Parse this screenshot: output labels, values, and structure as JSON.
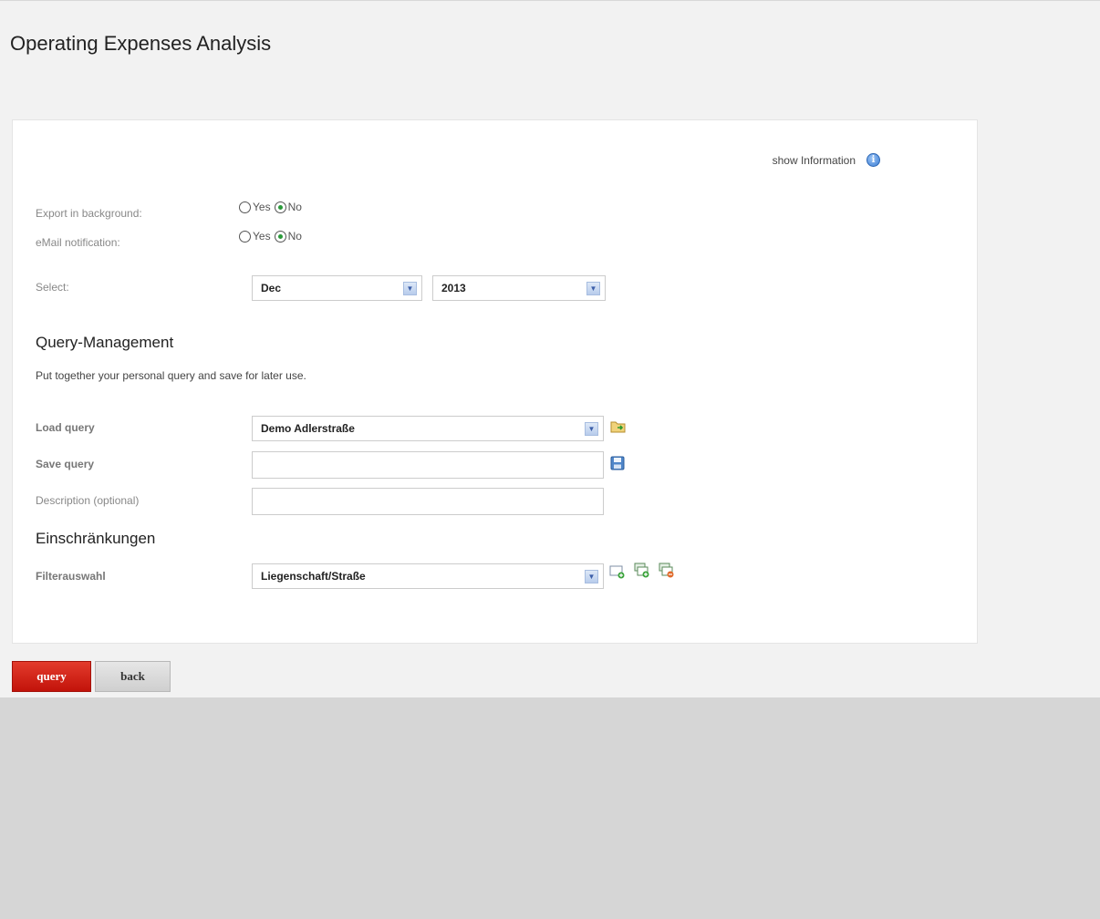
{
  "page": {
    "title": "Operating Expenses Analysis"
  },
  "info": {
    "label": "show Information"
  },
  "export_background": {
    "label": "Export in background:",
    "yes": "Yes",
    "no": "No",
    "selected": "No"
  },
  "email_notification": {
    "label": "eMail notification:",
    "yes": "Yes",
    "no": "No",
    "selected": "No"
  },
  "select": {
    "label": "Select:",
    "month": "Dec",
    "year": "2013"
  },
  "query_management": {
    "title": "Query-Management",
    "hint": "Put together your personal query and save for later use.",
    "load_label": "Load query",
    "load_value": "Demo Adlerstraße",
    "save_label": "Save query",
    "save_value": "",
    "description_label": "Description (optional)",
    "description_value": ""
  },
  "restrictions": {
    "title": "Einschränkungen",
    "filter_label": "Filterauswahl",
    "filter_value": "Liegenschaft/Straße"
  },
  "buttons": {
    "query": "query",
    "back": "back"
  },
  "colors": {
    "primary_button": "#c91a10",
    "page_background": "#f2f2f2",
    "footer_background": "#d6d6d6"
  }
}
